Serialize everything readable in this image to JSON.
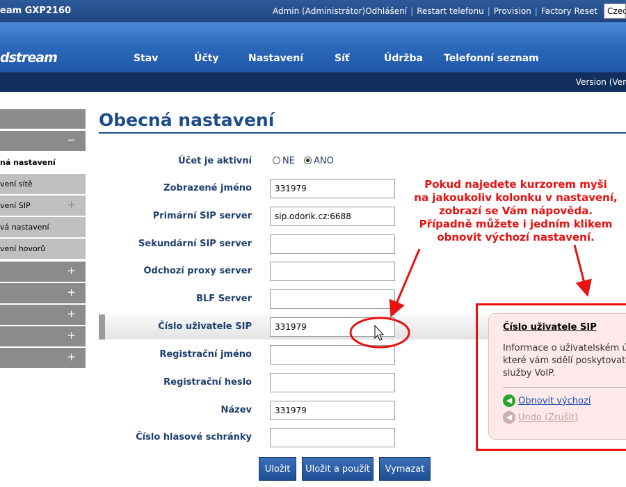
{
  "topbar": {
    "title": "eam GXP2160",
    "admin": "Admin (Administrátor)",
    "logout": "Odhlášení",
    "restart": "Restart telefonu",
    "provision": "Provision",
    "factory_reset": "Factory Reset",
    "language": "Czec"
  },
  "nav": {
    "logo": "dstream",
    "items": [
      "Stav",
      "Účty",
      "Nastavení",
      "Síť",
      "Údržba",
      "Telefonní seznam"
    ]
  },
  "version_bar": {
    "text": "Version (Ver"
  },
  "sidebar": {
    "items": [
      "ná nastavení",
      "vení sítě",
      "vení SIP",
      "vá nastavení",
      "vení hovorů"
    ]
  },
  "page": {
    "title": "Obecná nastavení"
  },
  "form": {
    "active_label": "Účet je aktivní",
    "radio_no": "NE",
    "radio_yes": "ANO",
    "radio_selected": "ANO",
    "display_name_label": "Zobrazené jméno",
    "display_name_value": "331979",
    "primary_sip_label": "Primární SIP server",
    "primary_sip_value": "sip.odorik.cz:6688",
    "secondary_sip_label": "Sekundární SIP server",
    "secondary_sip_value": "",
    "outbound_proxy_label": "Odchozí proxy server",
    "outbound_proxy_value": "",
    "blf_label": "BLF Server",
    "blf_value": "",
    "sip_user_label": "Číslo uživatele SIP",
    "sip_user_value": "331979",
    "reg_name_label": "Registrační jméno",
    "reg_name_value": "",
    "reg_pass_label": "Registrační heslo",
    "reg_pass_value": "",
    "name_label": "Název",
    "name_value": "331979",
    "voicemail_label": "Číslo hlasové schránky",
    "voicemail_value": ""
  },
  "buttons": {
    "save": "Uložit",
    "save_apply": "Uložit a použít",
    "clear": "Vymazat"
  },
  "annotation": {
    "line1": "Pokud najedete kurzorem myši",
    "line2": "na jakoukoliv kolonku v nastavení,",
    "line3": "zobrazí se Vám nápověda.",
    "line4": "Případně můžete i jedním klikem",
    "line5": "obnovit výchozí nastavení."
  },
  "help": {
    "title": "Číslo uživatele SIP",
    "line1": "Informace o uživatelském ú",
    "line2": "které vám sdělí poskytovate",
    "line3": "služby VoIP.",
    "restore": "Obnovit výchozí",
    "undo": "Undo (Zrušit)"
  },
  "colors": {
    "accent": "#1d4c8a",
    "annotation": "#e81010",
    "button": "#2a5ca6"
  }
}
